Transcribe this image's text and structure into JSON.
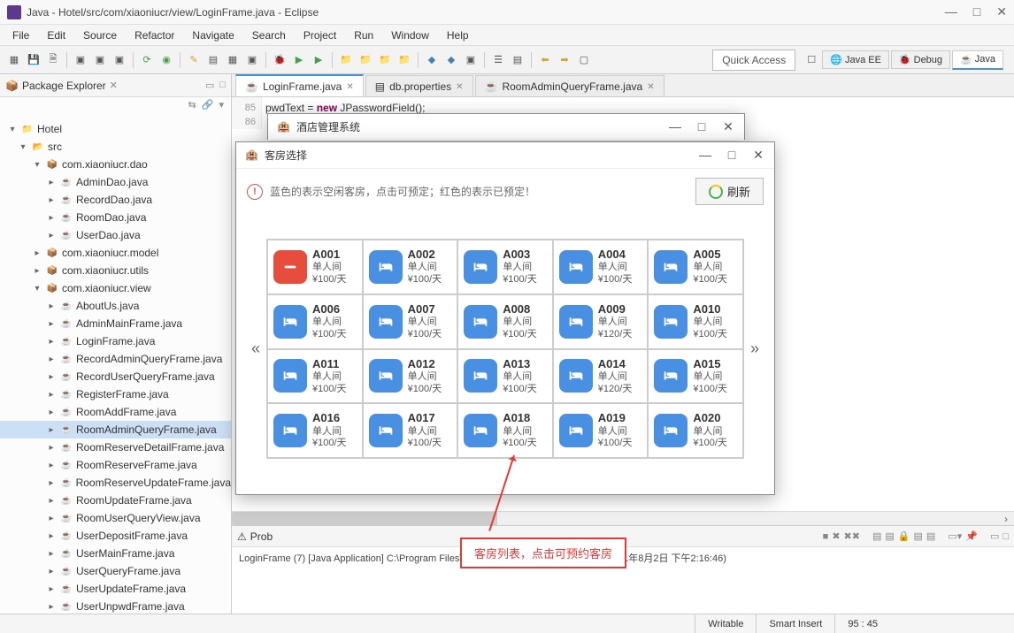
{
  "titlebar": {
    "text": "Java - Hotel/src/com/xiaoniucr/view/LoginFrame.java - Eclipse"
  },
  "menu": [
    "File",
    "Edit",
    "Source",
    "Refactor",
    "Navigate",
    "Search",
    "Project",
    "Run",
    "Window",
    "Help"
  ],
  "quick_access": "Quick Access",
  "perspectives": [
    {
      "label": "Java EE"
    },
    {
      "label": "Debug"
    },
    {
      "label": "Java"
    }
  ],
  "package_explorer": {
    "title": "Package Explorer",
    "project": "Hotel",
    "src": "src",
    "packages": [
      {
        "name": "com.xiaoniucr.dao",
        "open": true,
        "files": [
          "AdminDao.java",
          "RecordDao.java",
          "RoomDao.java",
          "UserDao.java"
        ]
      },
      {
        "name": "com.xiaoniucr.model",
        "open": false
      },
      {
        "name": "com.xiaoniucr.utils",
        "open": false
      },
      {
        "name": "com.xiaoniucr.view",
        "open": true,
        "files": [
          "AboutUs.java",
          "AdminMainFrame.java",
          "LoginFrame.java",
          "RecordAdminQueryFrame.java",
          "RecordUserQueryFrame.java",
          "RegisterFrame.java",
          "RoomAddFrame.java",
          "RoomAdminQueryFrame.java",
          "RoomReserveDetailFrame.java",
          "RoomReserveFrame.java",
          "RoomReserveUpdateFrame.java",
          "RoomUpdateFrame.java",
          "RoomUserQueryView.java",
          "UserDepositFrame.java",
          "UserMainFrame.java",
          "UserQueryFrame.java",
          "UserUpdateFrame.java",
          "UserUnpwdFrame.java"
        ]
      }
    ],
    "selected": "RoomAdminQueryFrame.java"
  },
  "editor_tabs": [
    {
      "icon": "java",
      "label": "LoginFrame.java",
      "active": true
    },
    {
      "icon": "file",
      "label": "db.properties"
    },
    {
      "icon": "java",
      "label": "RoomAdminQueryFrame.java"
    }
  ],
  "gutter_lines": [
    "85",
    "86"
  ],
  "code_fragment": {
    "var": "pwdText",
    "eq": " = ",
    "kw": "new",
    "rest": " JPasswordField();"
  },
  "dialogs": {
    "hotel_system": {
      "title": "酒店管理系统"
    },
    "room_select": {
      "title": "客房选择",
      "notice": "蓝色的表示空闲客房，点击可预定；红色的表示已预定！",
      "refresh": "刷新",
      "room_type": "单人间",
      "rooms": [
        {
          "id": "A001",
          "price": "¥100/天",
          "booked": true
        },
        {
          "id": "A002",
          "price": "¥100/天"
        },
        {
          "id": "A003",
          "price": "¥100/天"
        },
        {
          "id": "A004",
          "price": "¥100/天"
        },
        {
          "id": "A005",
          "price": "¥100/天"
        },
        {
          "id": "A006",
          "price": "¥100/天"
        },
        {
          "id": "A007",
          "price": "¥100/天"
        },
        {
          "id": "A008",
          "price": "¥100/天"
        },
        {
          "id": "A009",
          "price": "¥120/天"
        },
        {
          "id": "A010",
          "price": "¥100/天"
        },
        {
          "id": "A011",
          "price": "¥100/天"
        },
        {
          "id": "A012",
          "price": "¥100/天"
        },
        {
          "id": "A013",
          "price": "¥100/天"
        },
        {
          "id": "A014",
          "price": "¥120/天"
        },
        {
          "id": "A015",
          "price": "¥100/天"
        },
        {
          "id": "A016",
          "price": "¥100/天"
        },
        {
          "id": "A017",
          "price": "¥100/天"
        },
        {
          "id": "A018",
          "price": "¥100/天"
        },
        {
          "id": "A019",
          "price": "¥100/天"
        },
        {
          "id": "A020",
          "price": "¥100/天"
        }
      ]
    }
  },
  "console": {
    "tab": "Prob",
    "line": "LoginFrame (7) [Java Application] C:\\Program Files\\Java\\jre1.8.0_191\\bin\\javaw.exe (2021年8月2日 下午2:16:46)"
  },
  "annotation": "客房列表，点击可预约客房",
  "statusbar": {
    "writable": "Writable",
    "insert": "Smart Insert",
    "pos": "95 : 45"
  }
}
